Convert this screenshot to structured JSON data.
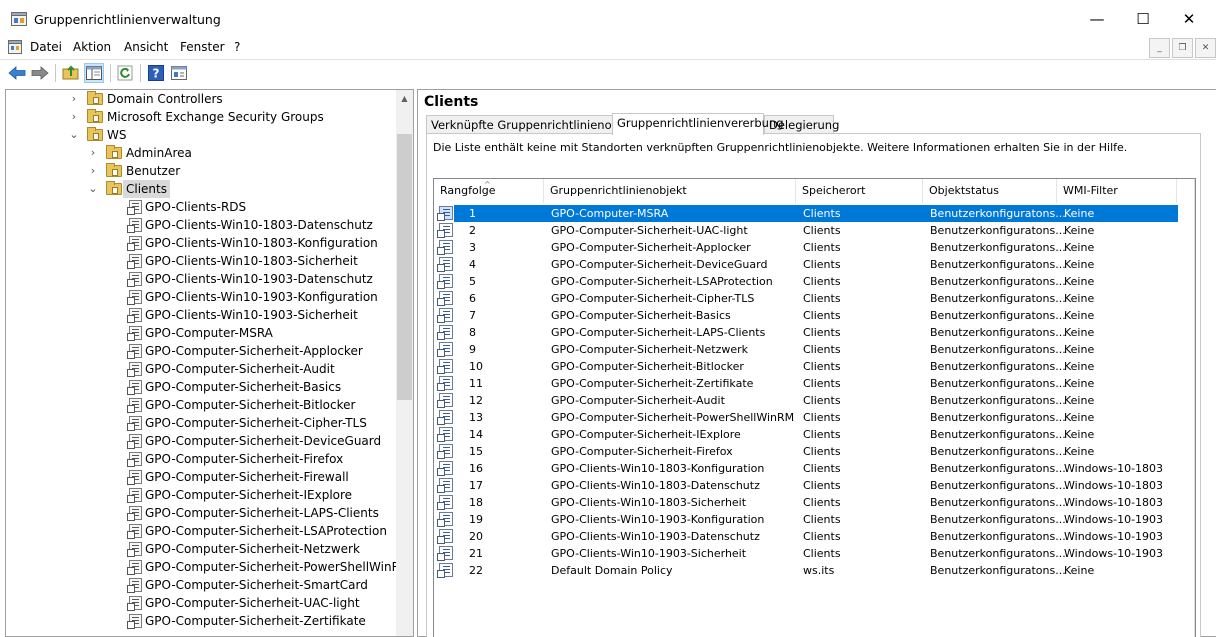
{
  "window": {
    "title": "Gruppenrichtlinienverwaltung",
    "minimize_glyph": "—",
    "maximize_glyph": "☐",
    "close_glyph": "✕"
  },
  "menu": {
    "items": [
      "Datei",
      "Aktion",
      "Ansicht",
      "Fenster",
      "?"
    ],
    "mdi_minimize": "_",
    "mdi_restore": "❐",
    "mdi_close": "✕"
  },
  "toolbar": {
    "icons": [
      "back-arrow-icon",
      "forward-arrow-icon",
      "up-folder-icon",
      "show-hide-tree-icon",
      "refresh-icon",
      "help-icon",
      "properties-icon"
    ]
  },
  "tree": {
    "rows": [
      {
        "label": "Domain Controllers",
        "type": "folder",
        "level": 1,
        "arrow": "›"
      },
      {
        "label": "Microsoft Exchange Security Groups",
        "type": "folder",
        "level": 1,
        "arrow": "›"
      },
      {
        "label": "WS",
        "type": "folder",
        "level": 1,
        "arrow": "⌄"
      },
      {
        "label": "AdminArea",
        "type": "folder",
        "level": 2,
        "arrow": "›"
      },
      {
        "label": "Benutzer",
        "type": "folder",
        "level": 2,
        "arrow": "›"
      },
      {
        "label": "Clients",
        "type": "folder",
        "level": 2,
        "arrow": "⌄",
        "selected": true
      },
      {
        "label": "GPO-Clients-RDS",
        "type": "gpo",
        "level": 3
      },
      {
        "label": "GPO-Clients-Win10-1803-Datenschutz",
        "type": "gpo",
        "level": 3
      },
      {
        "label": "GPO-Clients-Win10-1803-Konfiguration",
        "type": "gpo",
        "level": 3
      },
      {
        "label": "GPO-Clients-Win10-1803-Sicherheit",
        "type": "gpo",
        "level": 3
      },
      {
        "label": "GPO-Clients-Win10-1903-Datenschutz",
        "type": "gpo",
        "level": 3
      },
      {
        "label": "GPO-Clients-Win10-1903-Konfiguration",
        "type": "gpo",
        "level": 3
      },
      {
        "label": "GPO-Clients-Win10-1903-Sicherheit",
        "type": "gpo",
        "level": 3
      },
      {
        "label": "GPO-Computer-MSRA",
        "type": "gpo",
        "level": 3
      },
      {
        "label": "GPO-Computer-Sicherheit-Applocker",
        "type": "gpo",
        "level": 3
      },
      {
        "label": "GPO-Computer-Sicherheit-Audit",
        "type": "gpo",
        "level": 3
      },
      {
        "label": "GPO-Computer-Sicherheit-Basics",
        "type": "gpo",
        "level": 3
      },
      {
        "label": "GPO-Computer-Sicherheit-Bitlocker",
        "type": "gpo",
        "level": 3
      },
      {
        "label": "GPO-Computer-Sicherheit-Cipher-TLS",
        "type": "gpo",
        "level": 3
      },
      {
        "label": "GPO-Computer-Sicherheit-DeviceGuard",
        "type": "gpo",
        "level": 3
      },
      {
        "label": "GPO-Computer-Sicherheit-Firefox",
        "type": "gpo",
        "level": 3
      },
      {
        "label": "GPO-Computer-Sicherheit-Firewall",
        "type": "gpo",
        "level": 3
      },
      {
        "label": "GPO-Computer-Sicherheit-IExplore",
        "type": "gpo",
        "level": 3
      },
      {
        "label": "GPO-Computer-Sicherheit-LAPS-Clients",
        "type": "gpo",
        "level": 3
      },
      {
        "label": "GPO-Computer-Sicherheit-LSAProtection",
        "type": "gpo",
        "level": 3
      },
      {
        "label": "GPO-Computer-Sicherheit-Netzwerk",
        "type": "gpo",
        "level": 3
      },
      {
        "label": "GPO-Computer-Sicherheit-PowerShellWinRM",
        "type": "gpo",
        "level": 3
      },
      {
        "label": "GPO-Computer-Sicherheit-SmartCard",
        "type": "gpo",
        "level": 3
      },
      {
        "label": "GPO-Computer-Sicherheit-UAC-light",
        "type": "gpo",
        "level": 3
      },
      {
        "label": "GPO-Computer-Sicherheit-Zertifikate",
        "type": "gpo",
        "level": 3
      }
    ]
  },
  "details": {
    "heading": "Clients",
    "tabs": [
      "Verknüpfte Gruppenrichtlinienobjekte",
      "Gruppenrichtlinienvererbung",
      "Delegierung"
    ],
    "active_tab": 1,
    "info": "Die Liste enthält keine mit Standorten verknüpften Gruppenrichtlinienobjekte. Weitere Informationen erhalten Sie in der Hilfe.",
    "columns": [
      "Rangfolge",
      "Gruppenrichtlinienobjekt",
      "Speicherort",
      "Objektstatus",
      "WMI-Filter"
    ],
    "sort_arrow": "^",
    "rows": [
      {
        "rank": "1",
        "gpo": "GPO-Computer-MSRA",
        "location": "Clients",
        "status": "Benutzerkonfiguratons...",
        "wmi": "Keine",
        "selected": true
      },
      {
        "rank": "2",
        "gpo": "GPO-Computer-Sicherheit-UAC-light",
        "location": "Clients",
        "status": "Benutzerkonfiguratons...",
        "wmi": "Keine"
      },
      {
        "rank": "3",
        "gpo": "GPO-Computer-Sicherheit-Applocker",
        "location": "Clients",
        "status": "Benutzerkonfiguratons...",
        "wmi": "Keine"
      },
      {
        "rank": "4",
        "gpo": "GPO-Computer-Sicherheit-DeviceGuard",
        "location": "Clients",
        "status": "Benutzerkonfiguratons...",
        "wmi": "Keine"
      },
      {
        "rank": "5",
        "gpo": "GPO-Computer-Sicherheit-LSAProtection",
        "location": "Clients",
        "status": "Benutzerkonfiguratons...",
        "wmi": "Keine"
      },
      {
        "rank": "6",
        "gpo": "GPO-Computer-Sicherheit-Cipher-TLS",
        "location": "Clients",
        "status": "Benutzerkonfiguratons...",
        "wmi": "Keine"
      },
      {
        "rank": "7",
        "gpo": "GPO-Computer-Sicherheit-Basics",
        "location": "Clients",
        "status": "Benutzerkonfiguratons...",
        "wmi": "Keine"
      },
      {
        "rank": "8",
        "gpo": "GPO-Computer-Sicherheit-LAPS-Clients",
        "location": "Clients",
        "status": "Benutzerkonfiguratons...",
        "wmi": "Keine"
      },
      {
        "rank": "9",
        "gpo": "GPO-Computer-Sicherheit-Netzwerk",
        "location": "Clients",
        "status": "Benutzerkonfiguratons...",
        "wmi": "Keine"
      },
      {
        "rank": "10",
        "gpo": "GPO-Computer-Sicherheit-Bitlocker",
        "location": "Clients",
        "status": "Benutzerkonfiguratons...",
        "wmi": "Keine"
      },
      {
        "rank": "11",
        "gpo": "GPO-Computer-Sicherheit-Zertifikate",
        "location": "Clients",
        "status": "Benutzerkonfiguratons...",
        "wmi": "Keine"
      },
      {
        "rank": "12",
        "gpo": "GPO-Computer-Sicherheit-Audit",
        "location": "Clients",
        "status": "Benutzerkonfiguratons...",
        "wmi": "Keine"
      },
      {
        "rank": "13",
        "gpo": "GPO-Computer-Sicherheit-PowerShellWinRM",
        "location": "Clients",
        "status": "Benutzerkonfiguratons...",
        "wmi": "Keine"
      },
      {
        "rank": "14",
        "gpo": "GPO-Computer-Sicherheit-IExplore",
        "location": "Clients",
        "status": "Benutzerkonfiguratons...",
        "wmi": "Keine"
      },
      {
        "rank": "15",
        "gpo": "GPO-Computer-Sicherheit-Firefox",
        "location": "Clients",
        "status": "Benutzerkonfiguratons...",
        "wmi": "Keine"
      },
      {
        "rank": "16",
        "gpo": "GPO-Clients-Win10-1803-Konfiguration",
        "location": "Clients",
        "status": "Benutzerkonfiguratons...",
        "wmi": "Windows-10-1803"
      },
      {
        "rank": "17",
        "gpo": "GPO-Clients-Win10-1803-Datenschutz",
        "location": "Clients",
        "status": "Benutzerkonfiguratons...",
        "wmi": "Windows-10-1803"
      },
      {
        "rank": "18",
        "gpo": "GPO-Clients-Win10-1803-Sicherheit",
        "location": "Clients",
        "status": "Benutzerkonfiguratons...",
        "wmi": "Windows-10-1803"
      },
      {
        "rank": "19",
        "gpo": "GPO-Clients-Win10-1903-Konfiguration",
        "location": "Clients",
        "status": "Benutzerkonfiguratons...",
        "wmi": "Windows-10-1903"
      },
      {
        "rank": "20",
        "gpo": "GPO-Clients-Win10-1903-Datenschutz",
        "location": "Clients",
        "status": "Benutzerkonfiguratons...",
        "wmi": "Windows-10-1903"
      },
      {
        "rank": "21",
        "gpo": "GPO-Clients-Win10-1903-Sicherheit",
        "location": "Clients",
        "status": "Benutzerkonfiguratons...",
        "wmi": "Windows-10-1903"
      },
      {
        "rank": "22",
        "gpo": "Default Domain Policy",
        "location": "ws.its",
        "status": "Benutzerkonfiguratons...",
        "wmi": "Keine"
      }
    ]
  },
  "colors": {
    "selection": "#0078d7",
    "tree_selection": "#d9d9d9",
    "folder": "#e8c45a"
  }
}
